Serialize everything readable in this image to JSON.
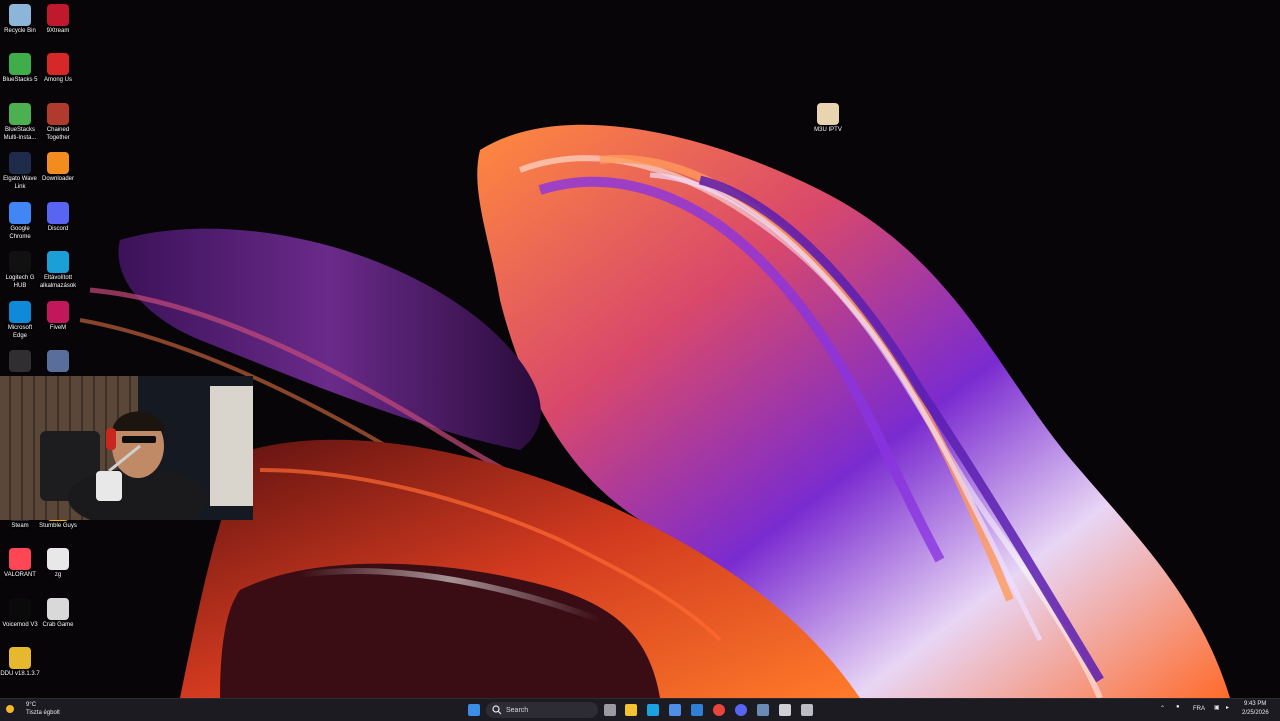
{
  "desktop": {
    "icons": [
      {
        "label": "Recycle Bin",
        "icon": "recycle-bin-icon",
        "color": "#8bb6d9"
      },
      {
        "label": "9Xtream",
        "icon": "9xtream-icon",
        "color": "#c0182c"
      },
      {
        "label": "BlueStacks 5",
        "icon": "bluestacks-icon",
        "color": "#3fae49"
      },
      {
        "label": "Among Us",
        "icon": "among-us-icon",
        "color": "#d62828"
      },
      {
        "label": "BlueStacks Multi-Insta...",
        "icon": "bluestacks-multi-instance-icon",
        "color": "#4caf50"
      },
      {
        "label": "Chained Together",
        "icon": "chained-together-icon",
        "color": "#b03a2e"
      },
      {
        "label": "Elgato Wave Link",
        "icon": "elgato-wave-link-icon",
        "color": "#1e2b4a"
      },
      {
        "label": "Downloader",
        "icon": "downloader-icon",
        "color": "#f28c1e"
      },
      {
        "label": "Google Chrome",
        "icon": "chrome-icon",
        "color": "#4285f4"
      },
      {
        "label": "Discord",
        "icon": "discord-icon",
        "color": "#5865f2"
      },
      {
        "label": "Logitech G HUB",
        "icon": "logitech-g-hub-icon",
        "color": "#111111"
      },
      {
        "label": "Eltávolított alkalmazások",
        "icon": "edge-folder-icon",
        "color": "#1a9fd6"
      },
      {
        "label": "Microsoft Edge",
        "icon": "edge-icon",
        "color": "#0f8ad8"
      },
      {
        "label": "FiveM",
        "icon": "fivem-icon",
        "color": "#c2185b"
      },
      {
        "label": "",
        "icon": "obs-icon",
        "color": "#302e31"
      },
      {
        "label": "",
        "icon": "game-thumbnail-icon",
        "color": "#5a6e9c"
      },
      {
        "label": "Steam",
        "icon": "steam-icon",
        "color": "#1b2838"
      },
      {
        "label": "Stumble Guys",
        "icon": "stumble-guys-icon",
        "color": "#f5b800"
      },
      {
        "label": "VALORANT",
        "icon": "valorant-icon",
        "color": "#ff4655"
      },
      {
        "label": "zg",
        "icon": "text-file-icon",
        "color": "#e8e8e8"
      },
      {
        "label": "Voicemod V3",
        "icon": "voicemod-icon",
        "color": "#0a0a0a"
      },
      {
        "label": "Crab Game",
        "icon": "crab-game-icon",
        "color": "#d9d9d9"
      },
      {
        "label": "DDU v18.1.3.7",
        "icon": "ddu-folder-icon",
        "color": "#e6b82e"
      },
      {
        "label": "M3U IPTV",
        "icon": "m3u-iptv-icon",
        "color": "#e8d5b0"
      }
    ]
  },
  "taskbar": {
    "search_label": "Search",
    "weather_temp": "9°C",
    "weather_text": "Tiszta égbolt",
    "language": "FRA",
    "time": "9:43 PM",
    "date": "2/25/2026",
    "pinned": [
      {
        "icon": "windows-start-icon",
        "color": "#3a8ee6"
      },
      {
        "icon": "task-view-icon",
        "color": "#9a9aa2"
      },
      {
        "icon": "file-explorer-icon",
        "color": "#f2c230"
      },
      {
        "icon": "edge-taskbar-icon",
        "color": "#1aa3e0"
      },
      {
        "icon": "store-icon",
        "color": "#4e8ee8"
      },
      {
        "icon": "mail-icon",
        "color": "#2f7fd6"
      },
      {
        "icon": "chrome-taskbar-icon",
        "color": "#e8453c"
      },
      {
        "icon": "discord-taskbar-icon",
        "color": "#5865f2"
      },
      {
        "icon": "steam-taskbar-icon",
        "color": "#6a8bb5"
      },
      {
        "icon": "logitech-taskbar-icon",
        "color": "#cfcfd6"
      },
      {
        "icon": "obs-taskbar-icon",
        "color": "#bdbdc6"
      }
    ]
  }
}
